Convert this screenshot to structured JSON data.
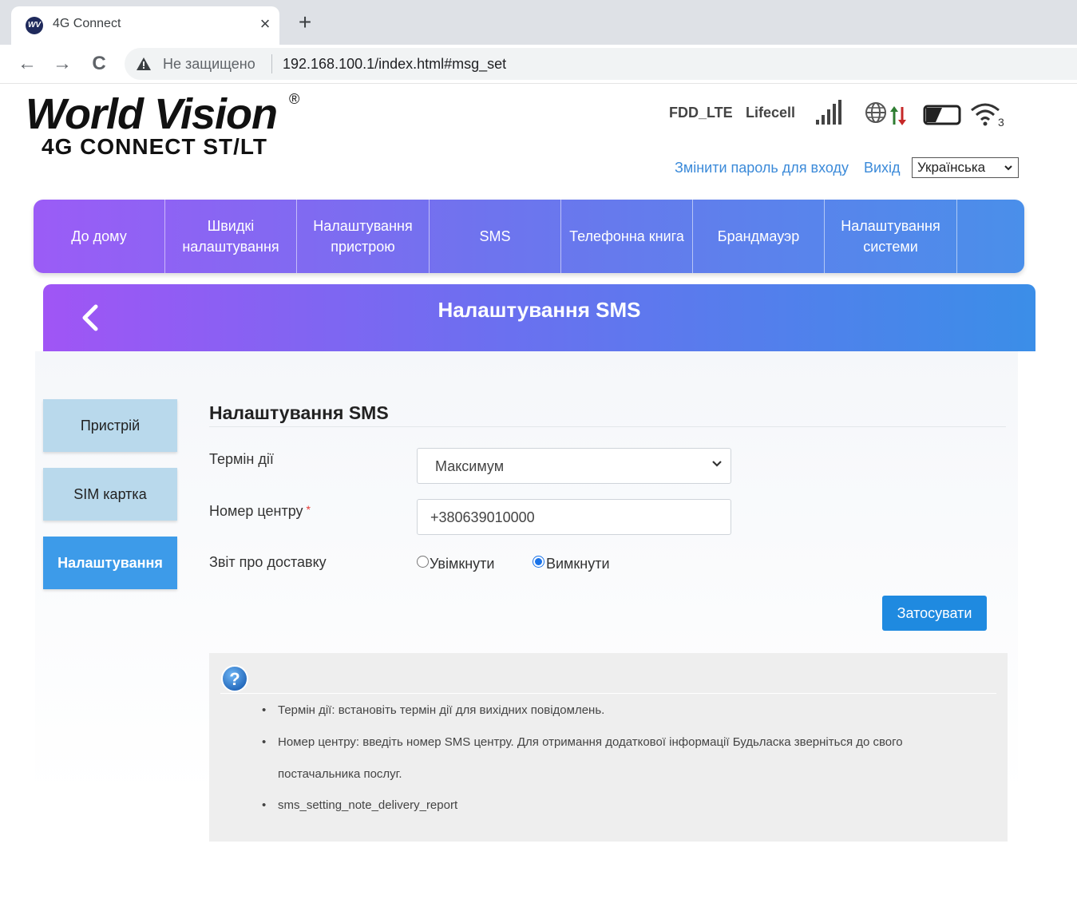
{
  "browser": {
    "tab_title": "4G Connect",
    "favicon_text": "WV",
    "close_glyph": "×",
    "newtab_glyph": "+",
    "back_glyph": "←",
    "forward_glyph": "→",
    "reload_glyph": "C",
    "security_text": "Не защищено",
    "url": "192.168.100.1/index.html#msg_set"
  },
  "header": {
    "logo_main": "World Vision",
    "logo_reg": "®",
    "logo_sub": "4G CONNECT ST/LT",
    "network_type": "FDD_LTE",
    "operator": "Lifecell",
    "wifi_clients": "3",
    "change_password": "Змінити пароль для входу",
    "logout": "Вихід",
    "language": "Українська"
  },
  "nav": [
    {
      "label": "До дому"
    },
    {
      "label": "Швидкі налаштування"
    },
    {
      "label": "Налаштування пристрою"
    },
    {
      "label": "SMS"
    },
    {
      "label": "Телефонна книга"
    },
    {
      "label": "Брандмауэр"
    },
    {
      "label": "Налаштування системи"
    }
  ],
  "page": {
    "title": "Налаштування SMS"
  },
  "sidebar": [
    {
      "label": "Пристрій",
      "active": false
    },
    {
      "label": "SIM картка",
      "active": false
    },
    {
      "label": "Налаштування",
      "active": true
    }
  ],
  "form": {
    "section_title": "Налаштування SMS",
    "validity_label": "Термін дії",
    "validity_value": "Максимум",
    "center_label": "Номер центру",
    "required_mark": "*",
    "center_value": "+380639010000",
    "report_label": "Звіт про доставку",
    "report_on": "Увімкнути",
    "report_off": "Вимкнути",
    "report_selected": "off",
    "apply": "Затосувати"
  },
  "help": {
    "icon_text": "?",
    "bullet": "•",
    "notes": [
      "Термін дії: встановіть термін дії для вихідних повідомлень.",
      "Номер центру: введіть номер SMS центру. Для отримання додаткової інформації Будьласка зверніться до свого",
      "постачальника послуг.",
      "sms_setting_note_delivery_report"
    ]
  },
  "colors": {
    "accent": "#1f8ae0",
    "nav_gradient_start": "#9b5cf6",
    "nav_gradient_end": "#4a8fea",
    "link": "#3b8ad9",
    "sidebar_inactive": "#b9d9ec",
    "sidebar_active": "#3d9be9"
  },
  "icons": [
    "warning-icon",
    "signal-icon",
    "globe-icon",
    "data-arrows-icon",
    "battery-icon",
    "wifi-icon",
    "back-chevron-icon",
    "help-icon",
    "chevron-down-icon"
  ]
}
